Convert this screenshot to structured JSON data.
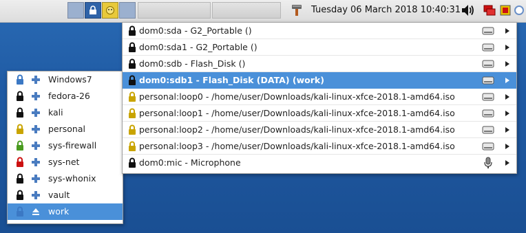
{
  "panel": {
    "clock": "Tuesday 06 March 2018 10:40:31",
    "tray_icons": [
      "volume-icon",
      "network-icon",
      "qubes-domains-icon",
      "updates-icon"
    ],
    "launcher_icon": "paint-brush-icon"
  },
  "vm_menu": {
    "items": [
      {
        "label": "Windows7",
        "lock_color": "#3b78c4",
        "icon": "plus-icon"
      },
      {
        "label": "fedora-26",
        "lock_color": "#111111",
        "icon": "plus-icon"
      },
      {
        "label": "kali",
        "lock_color": "#111111",
        "icon": "plus-icon"
      },
      {
        "label": "personal",
        "lock_color": "#c9a400",
        "icon": "plus-icon"
      },
      {
        "label": "sys-firewall",
        "lock_color": "#4a9b20",
        "icon": "plus-icon"
      },
      {
        "label": "sys-net",
        "lock_color": "#cc1111",
        "icon": "plus-icon"
      },
      {
        "label": "sys-whonix",
        "lock_color": "#111111",
        "icon": "plus-icon"
      },
      {
        "label": "vault",
        "lock_color": "#111111",
        "icon": "plus-icon"
      },
      {
        "label": "work",
        "lock_color": "#3b78c4",
        "icon": "eject-icon",
        "selected": true
      }
    ]
  },
  "device_menu": {
    "items": [
      {
        "label": "dom0:sda - G2_Portable ()",
        "lock_color": "#111111",
        "type": "drive"
      },
      {
        "label": "dom0:sda1 - G2_Portable ()",
        "lock_color": "#111111",
        "type": "drive"
      },
      {
        "label": "dom0:sdb - Flash_Disk ()",
        "lock_color": "#111111",
        "type": "drive"
      },
      {
        "label": "dom0:sdb1 - Flash_Disk (DATA) (work)",
        "lock_color": "#111111",
        "type": "drive",
        "selected": true
      },
      {
        "label": "personal:loop0 - /home/user/Downloads/kali-linux-xfce-2018.1-amd64.iso",
        "lock_color": "#c9a400",
        "type": "drive"
      },
      {
        "label": "personal:loop1 - /home/user/Downloads/kali-linux-xfce-2018.1-amd64.iso",
        "lock_color": "#c9a400",
        "type": "drive"
      },
      {
        "label": "personal:loop2 - /home/user/Downloads/kali-linux-xfce-2018.1-amd64.iso",
        "lock_color": "#c9a400",
        "type": "drive"
      },
      {
        "label": "personal:loop3 - /home/user/Downloads/kali-linux-xfce-2018.1-amd64.iso",
        "lock_color": "#c9a400",
        "type": "drive"
      },
      {
        "label": "dom0:mic - Microphone",
        "lock_color": "#111111",
        "type": "microphone"
      }
    ]
  }
}
